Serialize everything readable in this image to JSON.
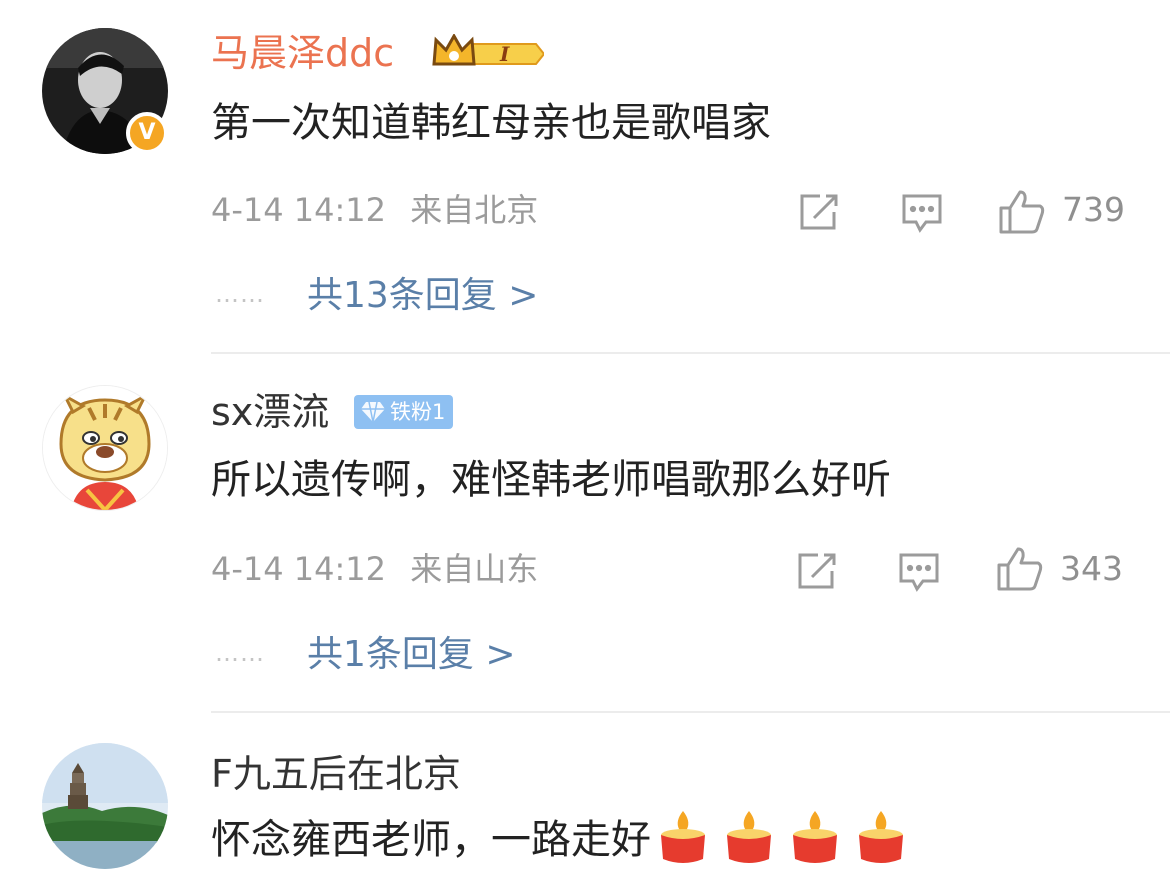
{
  "comments": [
    {
      "username": "马晨泽ddc",
      "badge_level": "I",
      "text": "第一次知道韩红母亲也是歌唱家",
      "time": "4-14 14:12",
      "location": "来自北京",
      "likes": "739",
      "replies": "共13条回复 >"
    },
    {
      "username": "sx漂流",
      "badge": "铁粉1",
      "text": "所以遗传啊，难怪韩老师唱歌那么好听",
      "time": "4-14 14:12",
      "location": "来自山东",
      "likes": "343",
      "replies": "共1条回复 >"
    },
    {
      "username": "F九五后在北京",
      "text": "怀念雍西老师，一路走好",
      "emoji_count": 4,
      "emoji_name": "candle-icon"
    }
  ],
  "icons": {
    "verified": "V",
    "repost": "repost-icon",
    "comment": "comment-icon",
    "like": "like-icon"
  },
  "dots": "……",
  "colors": {
    "vip_name": "#eb7350",
    "reply_link": "#5a7fa8",
    "verified_badge": "#f5a623",
    "fan_badge": "#8ec0f2"
  }
}
